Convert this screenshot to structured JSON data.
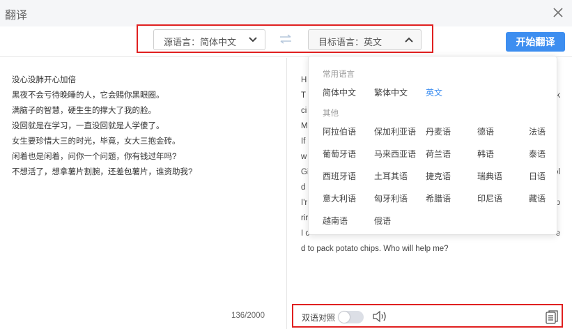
{
  "window": {
    "title": "翻译"
  },
  "toolbar": {
    "source_select": "源语言：简体中文",
    "target_select": "目标语言：英文",
    "start_button": "开始翻译"
  },
  "source": {
    "lines": [
      "没心没肺开心加倍",
      "黑夜不会亏待晚睡的人，它会赐你黑眼圈。",
      "满脑子的智慧，硬生生的撑大了我的脸。",
      "没回就是在学习，一直没回就是人学傻了。",
      "女生要珍惜大三的时光，毕竟，女大三抱金砖。",
      "闲着也是闲着，问你一个问题，你有钱过年吗?",
      "不想活了，想拿薯片割腕，还差包薯片，谁资助我?"
    ],
    "char_count": "136/2000"
  },
  "output": {
    "visible_lines": [
      "H",
      "T",
      "ci",
      "M",
      "If",
      "w",
      "Gi",
      "d",
      "I'r",
      "rir",
      "I c",
      "d to pack potato chips. Who will help me?"
    ],
    "right_edge_fragments": [
      {
        "text": "k",
        "row": 1
      },
      {
        "text": "ol",
        "row": 6
      },
      {
        "text": "p",
        "row": 8
      },
      {
        "text": "e",
        "row": 10
      }
    ]
  },
  "bottom": {
    "bilingual_label": "双语对照",
    "bilingual_on": false
  },
  "dropdown": {
    "common_heading": "常用语言",
    "common": [
      {
        "label": "简体中文",
        "selected": false
      },
      {
        "label": "繁体中文",
        "selected": false
      },
      {
        "label": "英文",
        "selected": true
      }
    ],
    "other_heading": "其他",
    "others": [
      "阿拉伯语",
      "保加利亚语",
      "丹麦语",
      "德语",
      "法语",
      "葡萄牙语",
      "马来西亚语",
      "荷兰语",
      "韩语",
      "泰语",
      "西班牙语",
      "土耳其语",
      "捷克语",
      "瑞典语",
      "日语",
      "意大利语",
      "匈牙利语",
      "希腊语",
      "印尼语",
      "藏语",
      "越南语",
      "俄语"
    ]
  },
  "colors": {
    "accent": "#3d8ef0",
    "highlight_border": "#e02020"
  },
  "icons": [
    "close-icon",
    "chevron-down-icon",
    "chevron-up-icon",
    "swap-icon",
    "speaker-icon",
    "copy-icon"
  ]
}
